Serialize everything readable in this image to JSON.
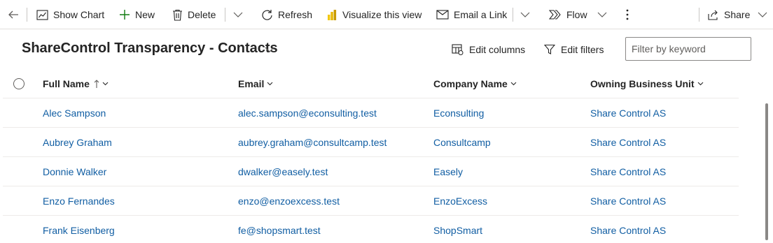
{
  "commandbar": {
    "show_chart": "Show Chart",
    "new": "New",
    "delete": "Delete",
    "refresh": "Refresh",
    "visualize": "Visualize this view",
    "email_link": "Email a Link",
    "flow": "Flow",
    "share": "Share"
  },
  "view": {
    "title": "ShareControl Transparency - Contacts",
    "edit_columns": "Edit columns",
    "edit_filters": "Edit filters",
    "filter_placeholder": "Filter by keyword"
  },
  "grid": {
    "columns": [
      "Full Name",
      "Email",
      "Company Name",
      "Owning Business Unit"
    ],
    "rows": [
      {
        "full_name": "Alec Sampson",
        "email": "alec.sampson@econsulting.test",
        "company": "Econsulting",
        "business_unit": "Share Control AS"
      },
      {
        "full_name": "Aubrey Graham",
        "email": "aubrey.graham@consultcamp.test",
        "company": "Consultcamp",
        "business_unit": "Share Control AS"
      },
      {
        "full_name": "Donnie Walker",
        "email": "dwalker@easely.test",
        "company": "Easely",
        "business_unit": "Share Control AS"
      },
      {
        "full_name": "Enzo Fernandes",
        "email": "enzo@enzoexcess.test",
        "company": "EnzoExcess",
        "business_unit": "Share Control AS"
      },
      {
        "full_name": "Frank Eisenberg",
        "email": "fe@shopsmart.test",
        "company": "ShopSmart",
        "business_unit": "Share Control AS"
      }
    ]
  },
  "icons": {
    "back": "back-arrow-icon",
    "show_chart": "chart-icon",
    "new": "plus-icon",
    "delete": "trash-icon",
    "refresh": "refresh-icon",
    "visualize": "power-bi-icon",
    "email_link": "email-icon",
    "flow": "flow-icon",
    "more": "more-vertical-icon",
    "share": "share-icon"
  },
  "colors": {
    "link": "#115ea3",
    "accent_green": "#107c10",
    "power_bi_yellow": "#f2c811",
    "text": "#242424",
    "divider": "#edebe9"
  }
}
